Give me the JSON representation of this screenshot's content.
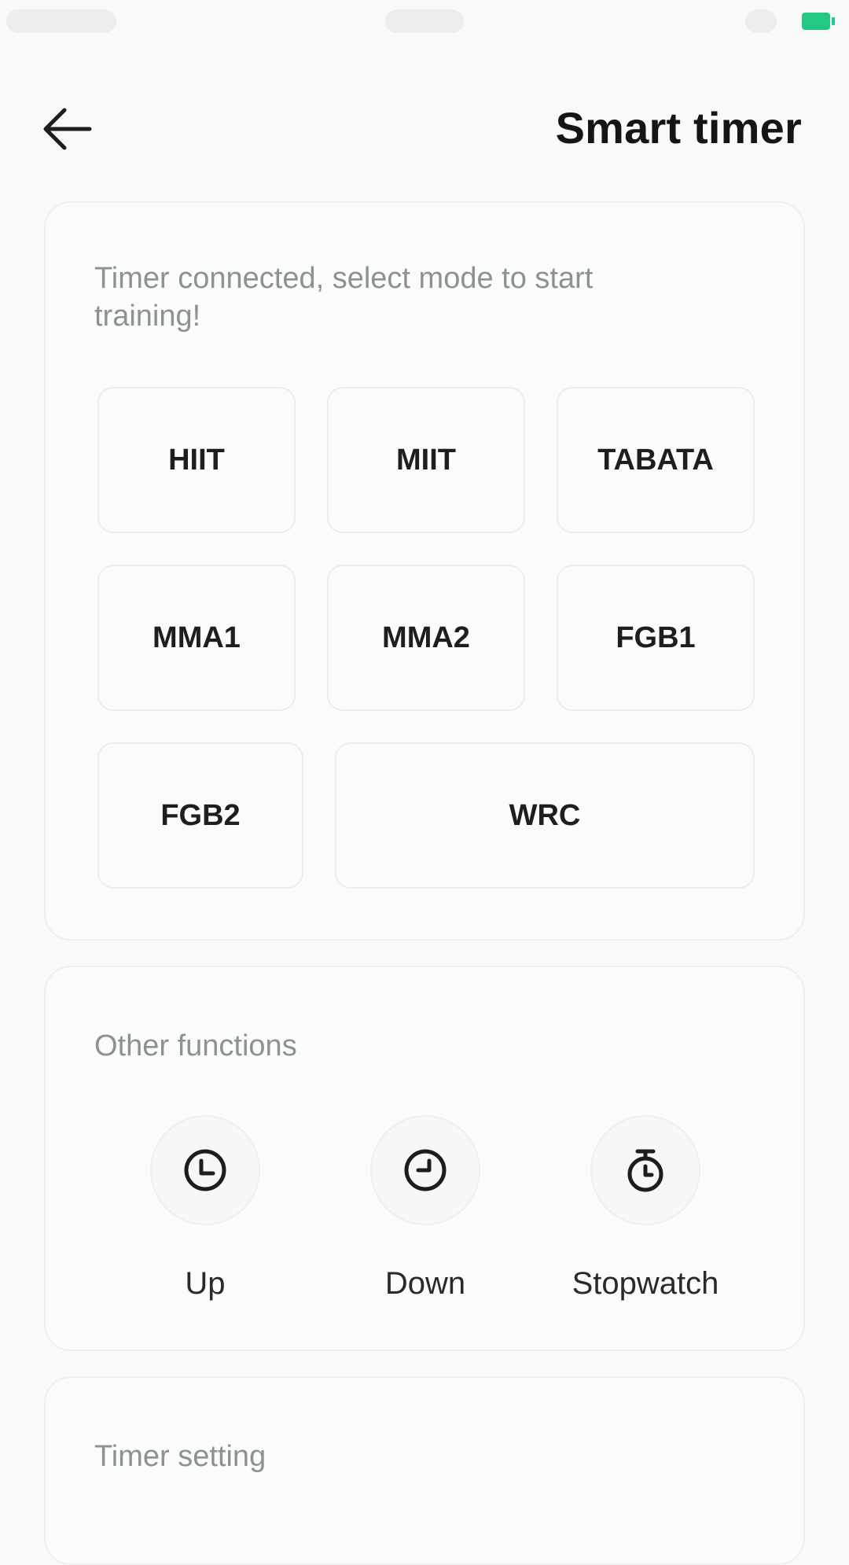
{
  "header": {
    "title": "Smart timer"
  },
  "modes_card": {
    "instruction": "Timer connected, select mode to start training!",
    "modes": [
      "HIIT",
      "MIIT",
      "TABATA",
      "MMA1",
      "MMA2",
      "FGB1",
      "FGB2",
      "WRC"
    ]
  },
  "functions_card": {
    "label": "Other functions",
    "items": [
      {
        "label": "Up",
        "icon": "clock-up-icon"
      },
      {
        "label": "Down",
        "icon": "clock-down-icon"
      },
      {
        "label": "Stopwatch",
        "icon": "stopwatch-icon"
      }
    ]
  },
  "settings_card": {
    "label": "Timer setting"
  },
  "colors": {
    "battery": "#23c883",
    "background": "#f8f9f9"
  }
}
